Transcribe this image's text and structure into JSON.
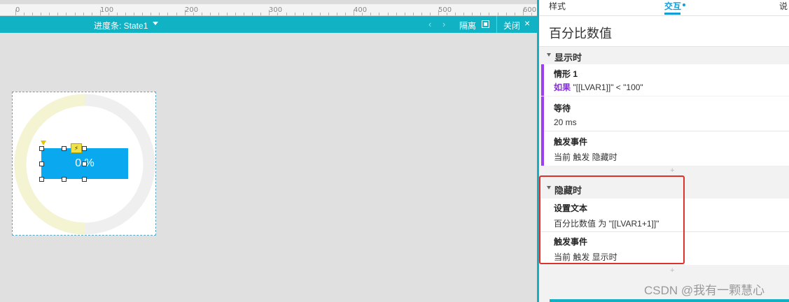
{
  "ruler": {
    "labels": [
      "0",
      "100",
      "200",
      "300",
      "400",
      "500",
      "600"
    ]
  },
  "state_bar": {
    "title": "进度条:  State1",
    "prev_icon": "‹",
    "next_icon": "›",
    "isolate_label": "隔离",
    "close_label": "关闭",
    "close_icon": "×"
  },
  "widget": {
    "value_text": "0 %",
    "lightning_icon": "⚡",
    "progress": 0.5
  },
  "panel": {
    "tabs": {
      "style": "样式",
      "interact": "交互",
      "notes": "说"
    },
    "widget_name": "百分比数值",
    "sections": [
      {
        "name": "显示时",
        "case_title": "情形 1",
        "case_keyword": "如果",
        "case_condition": "\"[[LVAR1]]\" < \"100\"",
        "actions": [
          {
            "title": "等待",
            "detail": "20 ms"
          },
          {
            "title": "触发事件",
            "detail": "当前 触发 隐藏时"
          }
        ]
      },
      {
        "name": "隐藏时",
        "actions": [
          {
            "title": "设置文本",
            "detail": "百分比数值 为 \"[[LVAR1+1]]\""
          },
          {
            "title": "触发事件",
            "detail": "当前 触发 显示时"
          }
        ]
      }
    ],
    "add_icon": "+"
  },
  "watermark": "CSDN @我有一颗慧心",
  "colors": {
    "accent_teal": "#13b0c3",
    "bar_blue": "#0aa8ef",
    "case_purple": "#9b3ff0",
    "highlight_red": "#e0302a",
    "ring_yellow": "#f4f4d2",
    "ring_gray": "#efefef"
  }
}
